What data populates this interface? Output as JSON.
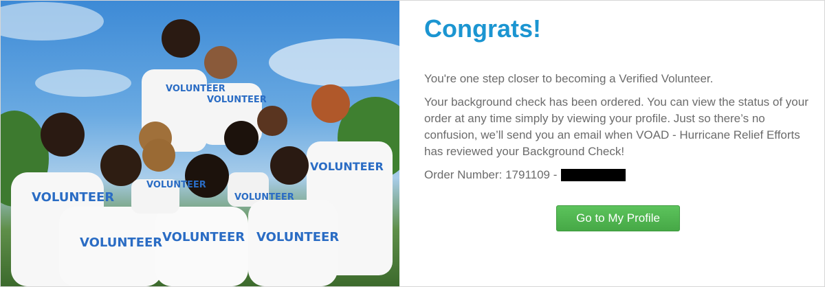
{
  "hero_image": {
    "shirt_text": "VOLUNTEER"
  },
  "confirmation": {
    "title": "Congrats!",
    "intro": "You're one step closer to becoming a Verified Volunteer.",
    "details": "Your background check has been ordered. You can view the status of your order at any time simply by viewing your profile. Just so there’s no confusion, we’ll send you an email when VOAD - Hurricane Relief Efforts has reviewed your Background Check!",
    "order_label": "Order Number: 1791109 -"
  },
  "actions": {
    "profile_button": "Go to My Profile"
  },
  "colors": {
    "title": "#1b95d1",
    "body_text": "#6b6b6b",
    "button": "#4cb34c"
  }
}
